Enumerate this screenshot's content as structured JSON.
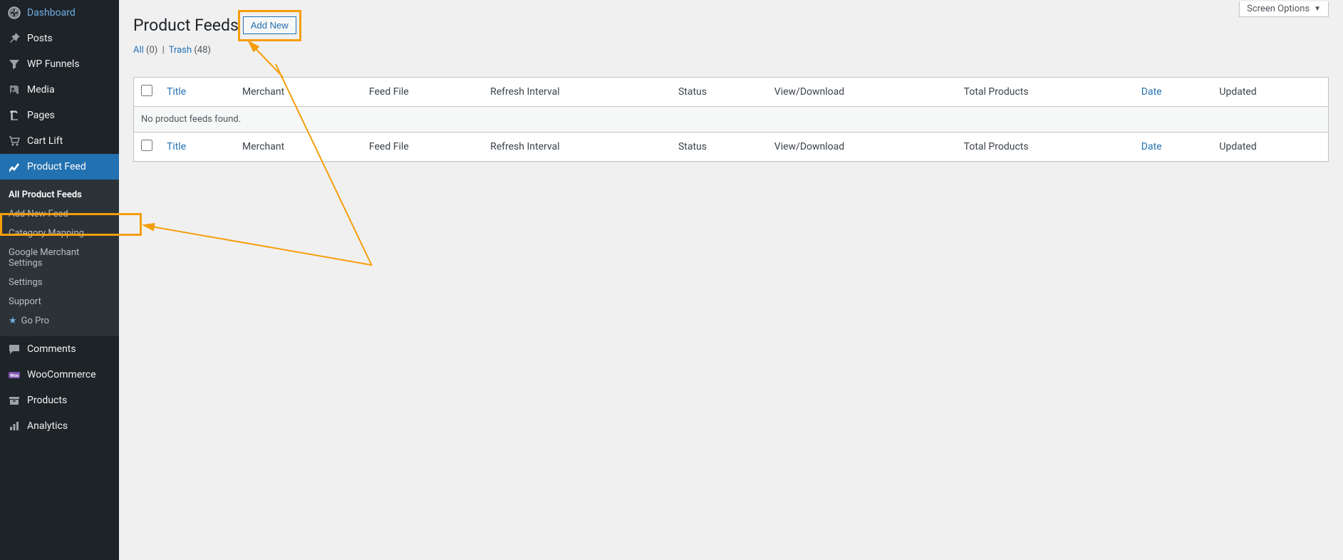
{
  "sidebar": {
    "items": [
      {
        "label": "Dashboard",
        "icon": "dashboard"
      },
      {
        "label": "Posts",
        "icon": "pin"
      },
      {
        "label": "WP Funnels",
        "icon": "funnel"
      },
      {
        "label": "Media",
        "icon": "media"
      },
      {
        "label": "Pages",
        "icon": "page"
      },
      {
        "label": "Cart Lift",
        "icon": "cart"
      },
      {
        "label": "Product Feed",
        "icon": "chart",
        "active": true
      },
      {
        "label": "Comments",
        "icon": "comment"
      },
      {
        "label": "WooCommerce",
        "icon": "woo"
      },
      {
        "label": "Products",
        "icon": "archive"
      },
      {
        "label": "Analytics",
        "icon": "analytics"
      }
    ],
    "submenu": [
      {
        "label": "All Product Feeds",
        "current": true
      },
      {
        "label": "Add New Feed"
      },
      {
        "label": "Category Mapping"
      },
      {
        "label": "Google Merchant Settings"
      },
      {
        "label": "Settings"
      },
      {
        "label": "Support"
      },
      {
        "label": "Go Pro",
        "gopro": true
      }
    ]
  },
  "header": {
    "title": "Product Feeds",
    "add_new_label": "Add New",
    "screen_options_label": "Screen Options"
  },
  "filters": {
    "all_label": "All",
    "all_count": "(0)",
    "sep": "|",
    "trash_label": "Trash",
    "trash_count": "(48)"
  },
  "table": {
    "columns": {
      "title": "Title",
      "merchant": "Merchant",
      "feed_file": "Feed File",
      "refresh_interval": "Refresh Interval",
      "status": "Status",
      "view_download": "View/Download",
      "total_products": "Total Products",
      "date": "Date",
      "updated": "Updated"
    },
    "empty_message": "No product feeds found."
  }
}
